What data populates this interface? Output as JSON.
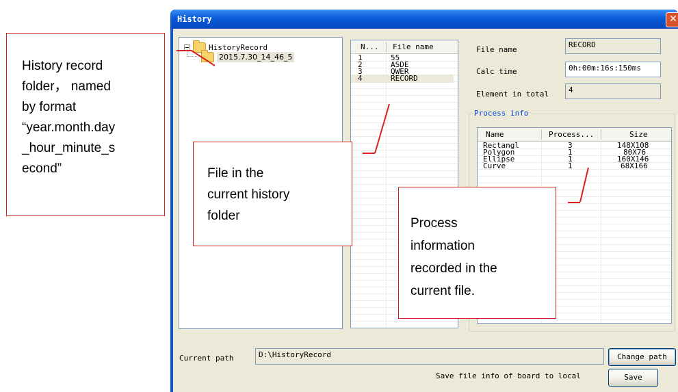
{
  "window": {
    "title": "History",
    "close_symbol": "✕"
  },
  "tree": {
    "root_label": "HistoryRecord",
    "child_label": "2015.7.30_14_46_5"
  },
  "file_list": {
    "headers": [
      "N...",
      "File name"
    ],
    "rows": [
      {
        "n": "1",
        "name": "55"
      },
      {
        "n": "2",
        "name": "ASDE"
      },
      {
        "n": "3",
        "name": "QWER"
      },
      {
        "n": "4",
        "name": "RECORD"
      }
    ],
    "selected_index": 3
  },
  "details": {
    "file_name_label": "File name",
    "file_name_value": "RECORD",
    "calc_time_label": "Calc time",
    "calc_time_value": "0h:00m:16s:150ms",
    "element_label": "Element in total",
    "element_value": "4"
  },
  "process_info": {
    "group_label": "Process info",
    "headers": [
      "Name",
      "Process...",
      "Size"
    ],
    "rows": [
      {
        "name": "Rectangl",
        "process": "3",
        "size": "148X108"
      },
      {
        "name": "Polygon",
        "process": "1",
        "size": "80X76"
      },
      {
        "name": "Ellipse",
        "process": "1",
        "size": "160X146"
      },
      {
        "name": "Curve",
        "process": "1",
        "size": "68X166"
      }
    ]
  },
  "path": {
    "label": "Current path",
    "value": "D:\\HistoryRecord",
    "change_button": "Change path"
  },
  "save": {
    "label": "Save file info of board to local",
    "button": "Save"
  },
  "annotations": {
    "folder_note": [
      "History record",
      "folder， named",
      "by format",
      "“year.month.day",
      "_hour_minute_s",
      "econd”"
    ],
    "file_note": [
      "File in the",
      "current history",
      "folder"
    ],
    "process_note": [
      "Process",
      "information",
      "recorded in the",
      "current file."
    ]
  },
  "colors": {
    "title_bar": "#0a58d4",
    "dialog_bg": "#ece9d8",
    "annotation_border": "#d82020",
    "group_label": "#0046d5"
  }
}
